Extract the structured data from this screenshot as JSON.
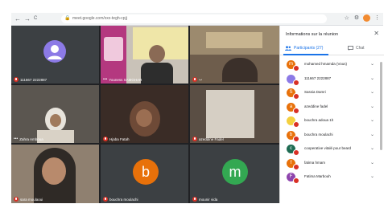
{
  "browser": {
    "back": "←",
    "forward": "→",
    "reload": "C",
    "url": "meet.google.com/xxx-tegh-cpjj",
    "icons": [
      "lock-icon",
      "star-icon",
      "extension-icon",
      "menu-icon"
    ]
  },
  "tiles": [
    {
      "name": "111667 2222887",
      "type": "avatar",
      "initial": "",
      "color": "#8c7ae6"
    },
    {
      "name": "Youness SAMGHAR",
      "type": "video"
    },
    {
      "name": "ب",
      "type": "video"
    },
    {
      "name": "Zahra Amboua",
      "type": "video"
    },
    {
      "name": "Hjaba Fatah",
      "type": "video"
    },
    {
      "name": "azeddine Fadel",
      "type": "video"
    },
    {
      "name": "sara moulaoui",
      "type": "video"
    },
    {
      "name": "bouchra moulachi",
      "type": "avatar",
      "initial": "b",
      "color": "#e8710a"
    },
    {
      "name": "mounir vida",
      "type": "avatar",
      "initial": "m",
      "color": "#33a852"
    }
  ],
  "panel": {
    "title": "Informations sur la réunion",
    "close": "✕",
    "tab_people": "Participants (27)",
    "tab_chat": "Chat",
    "participants": [
      {
        "name": "mohamed hmamda (Vous)",
        "initial": "m",
        "color": "#e8710a"
      },
      {
        "name": "111667 2222887",
        "initial": "",
        "color": "#8c7ae6"
      },
      {
        "name": "Sassia Damri",
        "initial": "S",
        "color": "#e8710a"
      },
      {
        "name": "azeddine fadel",
        "initial": "a",
        "color": "#e8710a"
      },
      {
        "name": "bouchra adoua 1h",
        "initial": "",
        "color": "#f4d03f"
      },
      {
        "name": "bouchra moulachi",
        "initial": "b",
        "color": "#e8710a"
      },
      {
        "name": "cooperative vitalé pour beard",
        "initial": "c",
        "color": "#1e6b52"
      },
      {
        "name": "fatima hmam",
        "initial": "f",
        "color": "#e8710a"
      },
      {
        "name": "Fatima Marbouh",
        "initial": "F",
        "color": "#8e44ad"
      }
    ]
  }
}
